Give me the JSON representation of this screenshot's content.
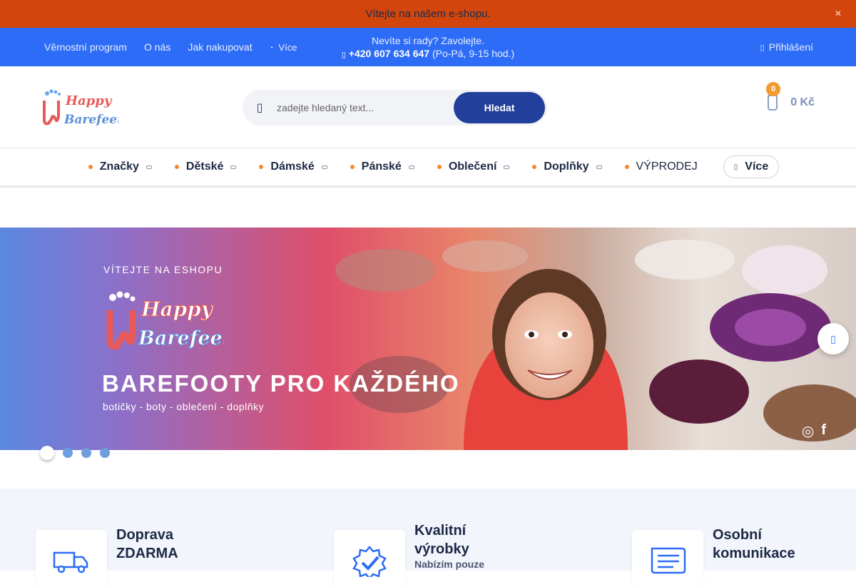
{
  "announcement": {
    "text": "Vítejte na našem e-shopu.",
    "close_icon": "✕"
  },
  "topbar": {
    "links": [
      "Věrnostní program",
      "O nás",
      "Jak nakupovat"
    ],
    "more_label": "Více",
    "help_text": "Nevíte si rady? Zavolejte.",
    "phone": "+420 607 634 647",
    "hours": "(Po-Pá, 9-15 hod.)",
    "login_label": "Přihlášení"
  },
  "header": {
    "logo_text_1": "Happy",
    "logo_text_2": "Barefeet",
    "search_placeholder": "zadejte hledaný text...",
    "search_button": "Hledat",
    "cart_count": "0",
    "cart_total": "0 Kč"
  },
  "categories": [
    {
      "label": "Značky",
      "dropdown": true
    },
    {
      "label": "Dětské",
      "dropdown": true
    },
    {
      "label": "Dámské",
      "dropdown": true
    },
    {
      "label": "Pánské",
      "dropdown": true
    },
    {
      "label": "Oblečení",
      "dropdown": true
    },
    {
      "label": "Doplňky",
      "dropdown": true
    },
    {
      "label": "VÝPRODEJ",
      "dropdown": false
    }
  ],
  "categories_more": "Více",
  "hero": {
    "welcome": "VÍTEJTE NA ESHOPU",
    "logo_text_1": "Happy",
    "logo_text_2": "Barefeet",
    "headline": "BAREFOOTY PRO KAŽDÉHO",
    "subline": "botičky - boty - oblečení - doplňky",
    "slides": 4,
    "active_slide": 1
  },
  "benefits": [
    {
      "title": "Doprava\nZDARMA",
      "subtitle": "",
      "icon": "truck-icon"
    },
    {
      "title": "Kvalitní\nvýrobky",
      "subtitle": "Nabízím pouze",
      "icon": "quality-badge-icon"
    },
    {
      "title": "Osobní\nkomunikace",
      "subtitle": "",
      "icon": "message-icon"
    }
  ],
  "colors": {
    "announce_bg": "#d2460d",
    "topbar_bg": "#2d6cf6",
    "search_button": "#213f9b",
    "accent_bullet": "#f08a2e"
  }
}
